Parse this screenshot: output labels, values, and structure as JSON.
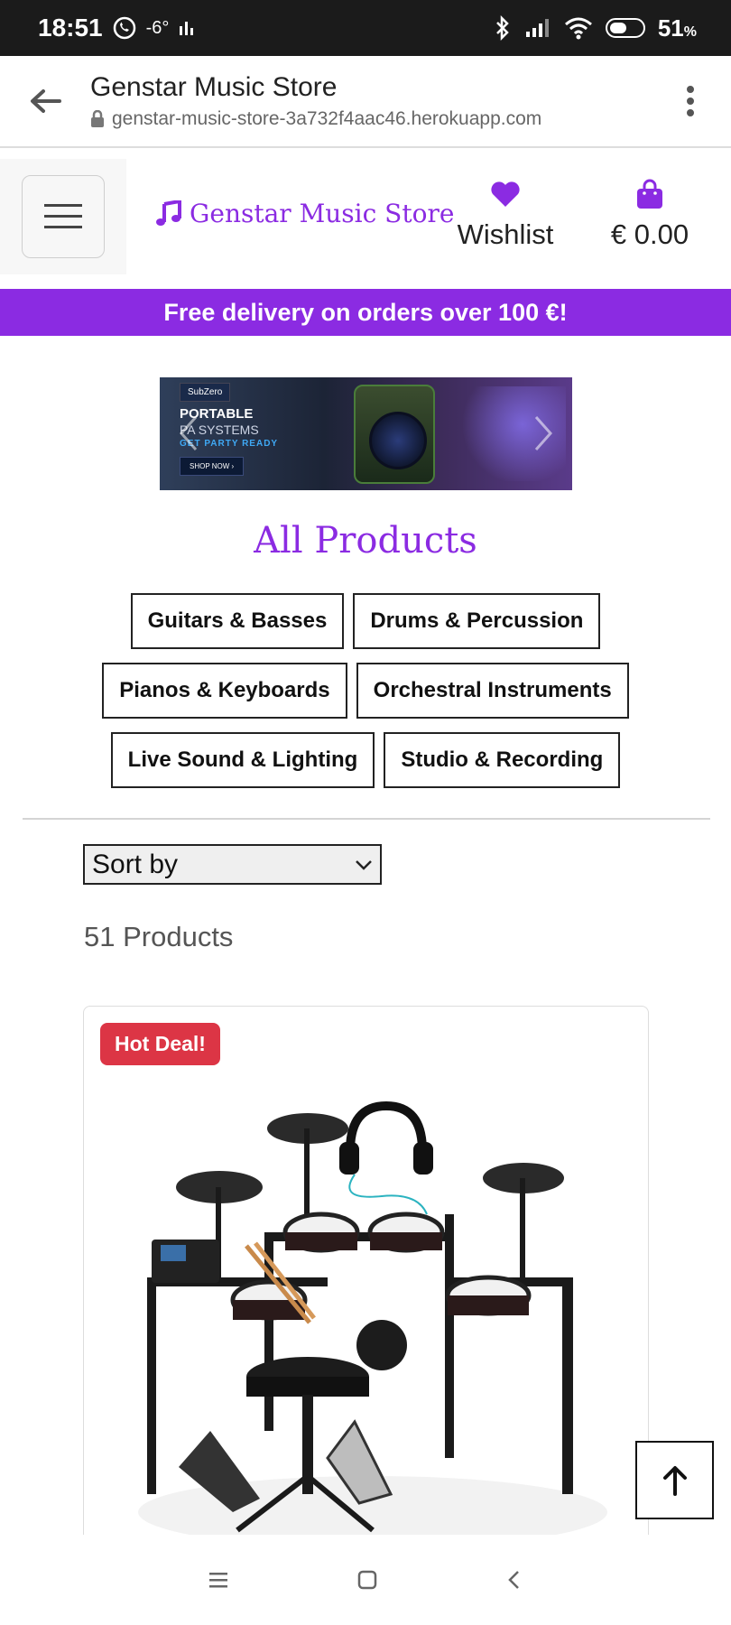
{
  "status_bar": {
    "time": "18:51",
    "temperature": "-6°",
    "battery": "51",
    "battery_unit": "%"
  },
  "browser": {
    "title": "Genstar Music Store",
    "url": "genstar-music-store-3a732f4aac46.herokuapp.com"
  },
  "header": {
    "brand": "Genstar Music Store",
    "wishlist_label": "Wishlist",
    "cart_total": "€ 0.00"
  },
  "promo": {
    "text": "Free delivery on orders over 100 €!"
  },
  "banner": {
    "brand_tag": "SubZero",
    "line1": "PORTABLE",
    "line2": "PA SYSTEMS",
    "line3": "GET PARTY READY",
    "cta": "SHOP NOW ›"
  },
  "products": {
    "title": "All Products",
    "categories": [
      "Guitars & Basses",
      "Drums & Percussion",
      "Pianos & Keyboards",
      "Orchestral Instruments",
      "Live Sound & Lighting",
      "Studio & Recording"
    ],
    "sort_label": "Sort by",
    "count_text": "51 Products"
  },
  "product_card": {
    "badge": "Hot Deal!"
  },
  "colors": {
    "accent": "#8b2be2",
    "badge": "#dc3545"
  }
}
